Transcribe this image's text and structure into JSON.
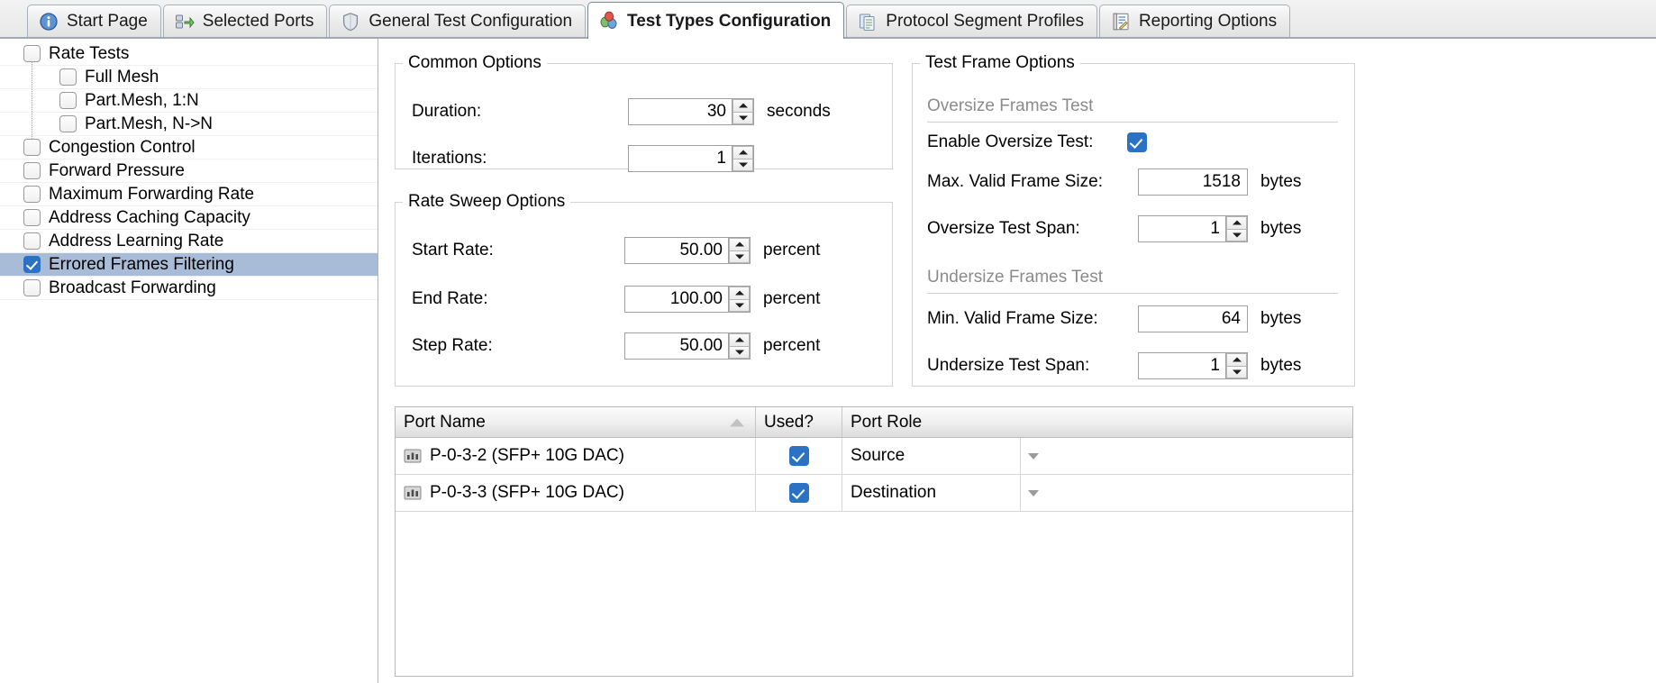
{
  "tabs": [
    {
      "label": "Start Page",
      "icon": "info-icon",
      "active": false
    },
    {
      "label": "Selected Ports",
      "icon": "ports-icon",
      "active": false
    },
    {
      "label": "General Test Configuration",
      "icon": "shield-icon",
      "active": false
    },
    {
      "label": "Test Types Configuration",
      "icon": "test-types-icon",
      "active": true
    },
    {
      "label": "Protocol Segment Profiles",
      "icon": "documents-icon",
      "active": false
    },
    {
      "label": "Reporting Options",
      "icon": "report-icon",
      "active": false
    }
  ],
  "tree": [
    {
      "label": "Rate Tests",
      "level": 0,
      "checked": false,
      "selected": false
    },
    {
      "label": "Full Mesh",
      "level": 1,
      "checked": false,
      "selected": false
    },
    {
      "label": "Part.Mesh, 1:N",
      "level": 1,
      "checked": false,
      "selected": false
    },
    {
      "label": "Part.Mesh, N->N",
      "level": 1,
      "checked": false,
      "selected": false
    },
    {
      "label": "Congestion Control",
      "level": 0,
      "checked": false,
      "selected": false
    },
    {
      "label": "Forward Pressure",
      "level": 0,
      "checked": false,
      "selected": false
    },
    {
      "label": "Maximum Forwarding Rate",
      "level": 0,
      "checked": false,
      "selected": false
    },
    {
      "label": "Address Caching Capacity",
      "level": 0,
      "checked": false,
      "selected": false
    },
    {
      "label": "Address Learning Rate",
      "level": 0,
      "checked": false,
      "selected": false
    },
    {
      "label": "Errored Frames Filtering",
      "level": 0,
      "checked": true,
      "selected": true
    },
    {
      "label": "Broadcast Forwarding",
      "level": 0,
      "checked": false,
      "selected": false
    }
  ],
  "common_options": {
    "legend": "Common Options",
    "duration": {
      "label": "Duration:",
      "value": "30",
      "unit": "seconds"
    },
    "iterations": {
      "label": "Iterations:",
      "value": "1",
      "unit": ""
    }
  },
  "rate_sweep_options": {
    "legend": "Rate Sweep Options",
    "start_rate": {
      "label": "Start Rate:",
      "value": "50.00",
      "unit": "percent"
    },
    "end_rate": {
      "label": "End Rate:",
      "value": "100.00",
      "unit": "percent"
    },
    "step_rate": {
      "label": "Step Rate:",
      "value": "50.00",
      "unit": "percent"
    }
  },
  "test_frame_options": {
    "legend": "Test Frame Options",
    "oversize_header": "Oversize Frames Test",
    "enable_oversize": {
      "label": "Enable Oversize Test:",
      "checked": true
    },
    "max_valid_frame_size": {
      "label": "Max. Valid Frame Size:",
      "value": "1518",
      "unit": "bytes"
    },
    "oversize_test_span": {
      "label": "Oversize Test Span:",
      "value": "1",
      "unit": "bytes"
    },
    "undersize_header": "Undersize Frames Test",
    "min_valid_frame_size": {
      "label": "Min. Valid Frame Size:",
      "value": "64",
      "unit": "bytes"
    },
    "undersize_test_span": {
      "label": "Undersize Test Span:",
      "value": "1",
      "unit": "bytes"
    }
  },
  "port_table": {
    "columns": [
      {
        "label": "Port Name",
        "sort": "ascending"
      },
      {
        "label": "Used?",
        "sort": ""
      },
      {
        "label": "Port Role",
        "sort": ""
      }
    ],
    "rows": [
      {
        "port_name": "P-0-3-2 (SFP+ 10G DAC)",
        "used": true,
        "port_role": "Source"
      },
      {
        "port_name": "P-0-3-3 (SFP+ 10G DAC)",
        "used": true,
        "port_role": "Destination"
      }
    ]
  },
  "colors": {
    "accent_blue": "#2b71c4",
    "selection_blue": "#a8bcd8",
    "dim_text": "#8b8b8b"
  }
}
